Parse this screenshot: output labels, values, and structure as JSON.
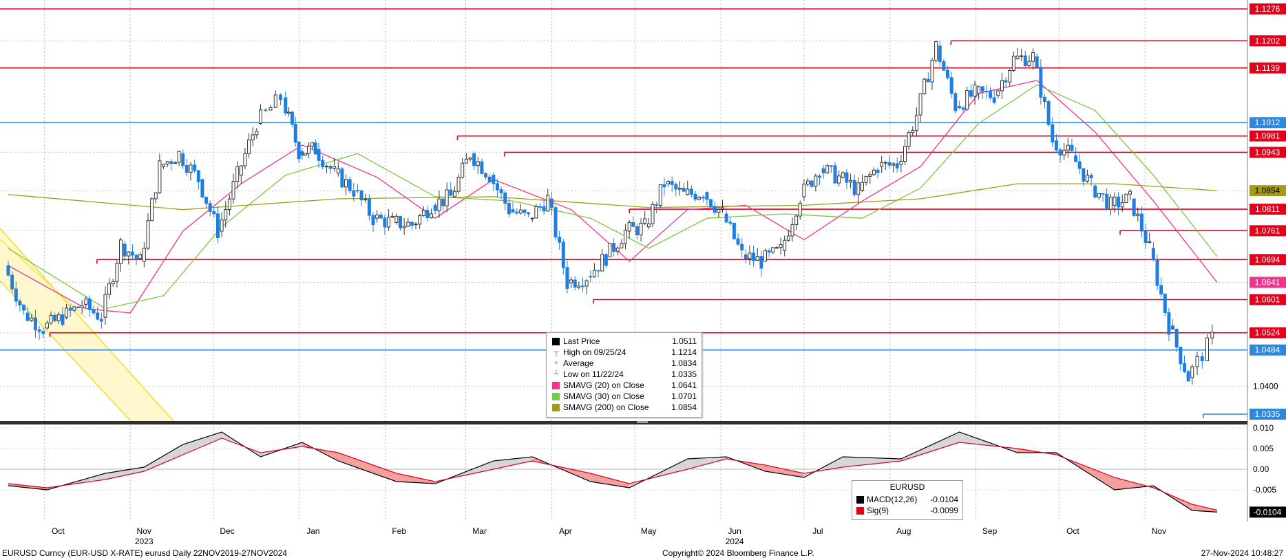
{
  "chart_data": {
    "type": "candlestick",
    "instrument": "EURUSD",
    "price_axis": {
      "ylim": [
        1.03,
        1.13
      ],
      "ticks": [
        "1.0400"
      ]
    },
    "macd_axis": {
      "ylim": [
        -0.0125,
        0.0125
      ],
      "ticks": [
        "0.010",
        "0.005",
        "0.00",
        "-0.005"
      ]
    },
    "x_axis": {
      "range": [
        "2023-09-18",
        "2024-11-27"
      ],
      "months": [
        {
          "label": "Oct",
          "date": "2023-10-01"
        },
        {
          "label": "Nov",
          "date": "2023-11-01"
        },
        {
          "label": "Dec",
          "date": "2023-12-01"
        },
        {
          "label": "Jan",
          "date": "2024-01-01"
        },
        {
          "label": "Feb",
          "date": "2024-02-01"
        },
        {
          "label": "Mar",
          "date": "2024-03-01"
        },
        {
          "label": "Apr",
          "date": "2024-04-01"
        },
        {
          "label": "May",
          "date": "2024-05-01"
        },
        {
          "label": "Jun",
          "date": "2024-06-01"
        },
        {
          "label": "Jul",
          "date": "2024-07-01"
        },
        {
          "label": "Aug",
          "date": "2024-08-01"
        },
        {
          "label": "Sep",
          "date": "2024-09-01"
        },
        {
          "label": "Oct",
          "date": "2024-10-01"
        },
        {
          "label": "Nov",
          "date": "2024-11-01"
        }
      ],
      "years": [
        {
          "label": "2023",
          "date": "2023-11-01"
        },
        {
          "label": "2024",
          "date": "2024-06-01"
        }
      ]
    },
    "closes": [
      {
        "date": "2023-09-18",
        "close": 1.068
      },
      {
        "date": "2023-09-25",
        "close": 1.057
      },
      {
        "date": "2023-10-02",
        "close": 1.0535
      },
      {
        "date": "2023-10-09",
        "close": 1.056
      },
      {
        "date": "2023-10-16",
        "close": 1.059
      },
      {
        "date": "2023-10-23",
        "close": 1.056
      },
      {
        "date": "2023-10-30",
        "close": 1.073
      },
      {
        "date": "2023-11-06",
        "close": 1.069
      },
      {
        "date": "2023-11-13",
        "close": 1.091
      },
      {
        "date": "2023-11-20",
        "close": 1.094
      },
      {
        "date": "2023-11-27",
        "close": 1.088
      },
      {
        "date": "2023-12-04",
        "close": 1.076
      },
      {
        "date": "2023-12-11",
        "close": 1.089
      },
      {
        "date": "2023-12-18",
        "close": 1.101
      },
      {
        "date": "2023-12-27",
        "close": 1.107
      },
      {
        "date": "2024-01-02",
        "close": 1.0945
      },
      {
        "date": "2024-01-08",
        "close": 1.095
      },
      {
        "date": "2024-01-15",
        "close": 1.0895
      },
      {
        "date": "2024-01-22",
        "close": 1.0855
      },
      {
        "date": "2024-01-29",
        "close": 1.079
      },
      {
        "date": "2024-02-05",
        "close": 1.078
      },
      {
        "date": "2024-02-12",
        "close": 1.0775
      },
      {
        "date": "2024-02-19",
        "close": 1.082
      },
      {
        "date": "2024-02-26",
        "close": 1.084
      },
      {
        "date": "2024-03-04",
        "close": 1.094
      },
      {
        "date": "2024-03-11",
        "close": 1.089
      },
      {
        "date": "2024-03-18",
        "close": 1.081
      },
      {
        "date": "2024-03-25",
        "close": 1.079
      },
      {
        "date": "2024-04-01",
        "close": 1.0835
      },
      {
        "date": "2024-04-08",
        "close": 1.064
      },
      {
        "date": "2024-04-15",
        "close": 1.0655
      },
      {
        "date": "2024-04-22",
        "close": 1.07
      },
      {
        "date": "2024-04-29",
        "close": 1.076
      },
      {
        "date": "2024-05-06",
        "close": 1.077
      },
      {
        "date": "2024-05-13",
        "close": 1.087
      },
      {
        "date": "2024-05-20",
        "close": 1.0845
      },
      {
        "date": "2024-05-27",
        "close": 1.085
      },
      {
        "date": "2024-06-03",
        "close": 1.08
      },
      {
        "date": "2024-06-10",
        "close": 1.0705
      },
      {
        "date": "2024-06-17",
        "close": 1.069
      },
      {
        "date": "2024-06-24",
        "close": 1.0715
      },
      {
        "date": "2024-07-01",
        "close": 1.084
      },
      {
        "date": "2024-07-08",
        "close": 1.0905
      },
      {
        "date": "2024-07-15",
        "close": 1.0885
      },
      {
        "date": "2024-07-22",
        "close": 1.0855
      },
      {
        "date": "2024-07-29",
        "close": 1.091
      },
      {
        "date": "2024-08-05",
        "close": 1.0915
      },
      {
        "date": "2024-08-12",
        "close": 1.103
      },
      {
        "date": "2024-08-19",
        "close": 1.119
      },
      {
        "date": "2024-08-26",
        "close": 1.105
      },
      {
        "date": "2024-09-02",
        "close": 1.108
      },
      {
        "date": "2024-09-09",
        "close": 1.1075
      },
      {
        "date": "2024-09-16",
        "close": 1.116
      },
      {
        "date": "2024-09-23",
        "close": 1.1165
      },
      {
        "date": "2024-09-30",
        "close": 1.097
      },
      {
        "date": "2024-10-07",
        "close": 1.0935
      },
      {
        "date": "2024-10-14",
        "close": 1.0865
      },
      {
        "date": "2024-10-21",
        "close": 1.082
      },
      {
        "date": "2024-10-28",
        "close": 1.0835
      },
      {
        "date": "2024-11-04",
        "close": 1.072
      },
      {
        "date": "2024-11-11",
        "close": 1.054
      },
      {
        "date": "2024-11-18",
        "close": 1.042
      },
      {
        "date": "2024-11-27",
        "close": 1.0511
      }
    ],
    "sma": [
      {
        "name": "SMAVG (20)  on Close",
        "color": "#f0338d",
        "points": [
          {
            "date": "2023-09-18",
            "value": 1.068
          },
          {
            "date": "2023-10-16",
            "value": 1.058
          },
          {
            "date": "2023-11-01",
            "value": 1.057
          },
          {
            "date": "2023-11-20",
            "value": 1.076
          },
          {
            "date": "2023-12-11",
            "value": 1.087
          },
          {
            "date": "2024-01-02",
            "value": 1.096
          },
          {
            "date": "2024-01-29",
            "value": 1.0885
          },
          {
            "date": "2024-02-19",
            "value": 1.079
          },
          {
            "date": "2024-03-11",
            "value": 1.088
          },
          {
            "date": "2024-04-08",
            "value": 1.081
          },
          {
            "date": "2024-04-29",
            "value": 1.069
          },
          {
            "date": "2024-05-20",
            "value": 1.081
          },
          {
            "date": "2024-06-10",
            "value": 1.082
          },
          {
            "date": "2024-07-01",
            "value": 1.074
          },
          {
            "date": "2024-07-22",
            "value": 1.083
          },
          {
            "date": "2024-08-12",
            "value": 1.091
          },
          {
            "date": "2024-09-02",
            "value": 1.108
          },
          {
            "date": "2024-09-23",
            "value": 1.111
          },
          {
            "date": "2024-10-14",
            "value": 1.099
          },
          {
            "date": "2024-11-04",
            "value": 1.083
          },
          {
            "date": "2024-11-27",
            "value": 1.0641
          }
        ]
      },
      {
        "name": "SMAVG (30)  on Close",
        "color": "#7ac943",
        "points": [
          {
            "date": "2023-09-18",
            "value": 1.072
          },
          {
            "date": "2023-10-23",
            "value": 1.058
          },
          {
            "date": "2023-11-13",
            "value": 1.061
          },
          {
            "date": "2023-12-04",
            "value": 1.077
          },
          {
            "date": "2023-12-27",
            "value": 1.089
          },
          {
            "date": "2024-01-22",
            "value": 1.094
          },
          {
            "date": "2024-02-19",
            "value": 1.084
          },
          {
            "date": "2024-03-18",
            "value": 1.083
          },
          {
            "date": "2024-04-15",
            "value": 1.079
          },
          {
            "date": "2024-05-06",
            "value": 1.072
          },
          {
            "date": "2024-05-27",
            "value": 1.079
          },
          {
            "date": "2024-06-24",
            "value": 1.08
          },
          {
            "date": "2024-07-22",
            "value": 1.079
          },
          {
            "date": "2024-08-12",
            "value": 1.086
          },
          {
            "date": "2024-09-02",
            "value": 1.101
          },
          {
            "date": "2024-09-23",
            "value": 1.11
          },
          {
            "date": "2024-10-14",
            "value": 1.104
          },
          {
            "date": "2024-11-04",
            "value": 1.089
          },
          {
            "date": "2024-11-27",
            "value": 1.0701
          }
        ]
      },
      {
        "name": "SMAVG (200)  on Close",
        "color": "#a39a16",
        "points": [
          {
            "date": "2023-09-18",
            "value": 1.0845
          },
          {
            "date": "2023-11-20",
            "value": 1.081
          },
          {
            "date": "2024-01-15",
            "value": 1.0835
          },
          {
            "date": "2024-03-11",
            "value": 1.084
          },
          {
            "date": "2024-05-06",
            "value": 1.0815
          },
          {
            "date": "2024-07-01",
            "value": 1.082
          },
          {
            "date": "2024-08-12",
            "value": 1.0835
          },
          {
            "date": "2024-09-16",
            "value": 1.087
          },
          {
            "date": "2024-10-21",
            "value": 1.087
          },
          {
            "date": "2024-11-27",
            "value": 1.0854
          }
        ]
      }
    ],
    "level_lines": [
      {
        "price": "1.1276",
        "color": "#e3001b",
        "full": true
      },
      {
        "price": "1.1202",
        "color": "#e3001b",
        "start": "2024-08-23"
      },
      {
        "price": "1.1139",
        "color": "#e3001b",
        "full": true
      },
      {
        "price": "1.1012",
        "color": "#2e86de",
        "full": true
      },
      {
        "price": "1.0981",
        "color": "#e3001b",
        "start": "2024-02-27"
      },
      {
        "price": "1.0943",
        "color": "#e3001b",
        "start": "2024-03-15"
      },
      {
        "price": "1.0811",
        "color": "#e3001b",
        "start": "2024-04-29"
      },
      {
        "price": "1.0761",
        "color": "#e3001b",
        "start": "2024-10-23"
      },
      {
        "price": "1.0694",
        "color": "#e3001b",
        "start": "2023-10-20"
      },
      {
        "price": "1.0601",
        "color": "#e3001b",
        "start": "2024-04-16"
      },
      {
        "price": "1.0524",
        "color": "#e3001b",
        "start": "2023-10-03"
      },
      {
        "price": "1.0484",
        "color": "#2e86de",
        "full": true
      },
      {
        "price": "1.0335",
        "color": "#2e86de",
        "start": "2024-11-22"
      }
    ],
    "right_labels": [
      {
        "text": "1.1276",
        "price": 1.1276,
        "bg": "#e3001b",
        "fg": "#ffffff"
      },
      {
        "text": "1.1202",
        "price": 1.1202,
        "bg": "#e3001b",
        "fg": "#ffffff"
      },
      {
        "text": "1.1139",
        "price": 1.1139,
        "bg": "#e3001b",
        "fg": "#ffffff"
      },
      {
        "text": "1.1012",
        "price": 1.1012,
        "bg": "#2e86de",
        "fg": "#ffffff"
      },
      {
        "text": "1.0981",
        "price": 1.0981,
        "bg": "#e3001b",
        "fg": "#ffffff"
      },
      {
        "text": "1.0943",
        "price": 1.0943,
        "bg": "#e3001b",
        "fg": "#ffffff"
      },
      {
        "text": "1.0854",
        "price": 1.0854,
        "bg": "#a39a16",
        "fg": "#000000"
      },
      {
        "text": "1.0811",
        "price": 1.0811,
        "bg": "#e3001b",
        "fg": "#ffffff"
      },
      {
        "text": "1.0761",
        "price": 1.0761,
        "bg": "#e3001b",
        "fg": "#ffffff"
      },
      {
        "text": "1.0694",
        "price": 1.0694,
        "bg": "#e3001b",
        "fg": "#ffffff"
      },
      {
        "text": "1.0641",
        "price": 1.0641,
        "bg": "#f0338d",
        "fg": "#ffffff"
      },
      {
        "text": "1.0601",
        "price": 1.0601,
        "bg": "#e3001b",
        "fg": "#ffffff"
      },
      {
        "text": "1.0524",
        "price": 1.0524,
        "bg": "#e3001b",
        "fg": "#ffffff"
      },
      {
        "text": "1.0484",
        "price": 1.0484,
        "bg": "#2e86de",
        "fg": "#ffffff"
      },
      {
        "text": "1.0335",
        "price": 1.0335,
        "bg": "#2e86de",
        "fg": "#ffffff"
      }
    ],
    "legend": [
      {
        "kind": "swatch",
        "color": "#000000",
        "label": "Last Price",
        "value": "1.0511"
      },
      {
        "kind": "glyph",
        "glyph": "┬",
        "label": "High on 09/25/24",
        "value": "1.1214"
      },
      {
        "kind": "glyph",
        "glyph": "+",
        "label": "Average",
        "value": "1.0834"
      },
      {
        "kind": "glyph",
        "glyph": "┴",
        "label": "Low on 11/22/24",
        "value": "1.0335"
      },
      {
        "kind": "swatch",
        "color": "#f0338d",
        "label": "SMAVG (20)  on Close",
        "value": "1.0641"
      },
      {
        "kind": "swatch",
        "color": "#7ac943",
        "label": "SMAVG (30)  on Close",
        "value": "1.0701"
      },
      {
        "kind": "swatch",
        "color": "#a39a16",
        "label": "SMAVG (200)  on Close",
        "value": "1.0854"
      }
    ],
    "macd": {
      "title": "EURUSD",
      "series": [
        {
          "name": "MACD(12,26)",
          "color": "#000000",
          "value": "-0.0104"
        },
        {
          "name": "Sig(9)",
          "color": "#e3001b",
          "value": "-0.0099"
        }
      ],
      "last_label": "-0.0104",
      "points": [
        {
          "date": "2023-09-18",
          "macd": -0.004,
          "sig": -0.0035
        },
        {
          "date": "2023-10-02",
          "macd": -0.005,
          "sig": -0.0045
        },
        {
          "date": "2023-10-23",
          "macd": -0.001,
          "sig": -0.0025
        },
        {
          "date": "2023-11-06",
          "macd": 0.0005,
          "sig": -0.0005
        },
        {
          "date": "2023-11-20",
          "macd": 0.006,
          "sig": 0.0035
        },
        {
          "date": "2023-12-04",
          "macd": 0.009,
          "sig": 0.0075
        },
        {
          "date": "2023-12-18",
          "macd": 0.003,
          "sig": 0.004
        },
        {
          "date": "2024-01-02",
          "macd": 0.0065,
          "sig": 0.0055
        },
        {
          "date": "2024-01-15",
          "macd": 0.002,
          "sig": 0.004
        },
        {
          "date": "2024-02-05",
          "macd": -0.003,
          "sig": -0.001
        },
        {
          "date": "2024-02-19",
          "macd": -0.0035,
          "sig": -0.003
        },
        {
          "date": "2024-03-11",
          "macd": 0.002,
          "sig": 0.0
        },
        {
          "date": "2024-03-25",
          "macd": 0.003,
          "sig": 0.002
        },
        {
          "date": "2024-04-15",
          "macd": -0.003,
          "sig": -0.001
        },
        {
          "date": "2024-04-29",
          "macd": -0.0045,
          "sig": -0.0035
        },
        {
          "date": "2024-05-20",
          "macd": 0.0025,
          "sig": 0.0
        },
        {
          "date": "2024-06-03",
          "macd": 0.003,
          "sig": 0.0025
        },
        {
          "date": "2024-06-17",
          "macd": -0.0005,
          "sig": 0.001
        },
        {
          "date": "2024-07-01",
          "macd": -0.002,
          "sig": -0.001
        },
        {
          "date": "2024-07-15",
          "macd": 0.003,
          "sig": 0.0005
        },
        {
          "date": "2024-08-05",
          "macd": 0.0025,
          "sig": 0.002
        },
        {
          "date": "2024-08-26",
          "macd": 0.009,
          "sig": 0.0065
        },
        {
          "date": "2024-09-16",
          "macd": 0.004,
          "sig": 0.005
        },
        {
          "date": "2024-09-30",
          "macd": 0.004,
          "sig": 0.0035
        },
        {
          "date": "2024-10-21",
          "macd": -0.005,
          "sig": -0.002
        },
        {
          "date": "2024-11-04",
          "macd": -0.004,
          "sig": -0.0045
        },
        {
          "date": "2024-11-18",
          "macd": -0.01,
          "sig": -0.0085
        },
        {
          "date": "2024-11-27",
          "macd": -0.0104,
          "sig": -0.0099
        }
      ]
    }
  },
  "footer": {
    "left": "EURUSD Curncy (EUR-USD X-RATE) eurusd  Daily 22NOV2019-27NOV2024",
    "center": "Copyright© 2024 Bloomberg Finance L.P.",
    "right": "27-Nov-2024 10:48:27"
  }
}
